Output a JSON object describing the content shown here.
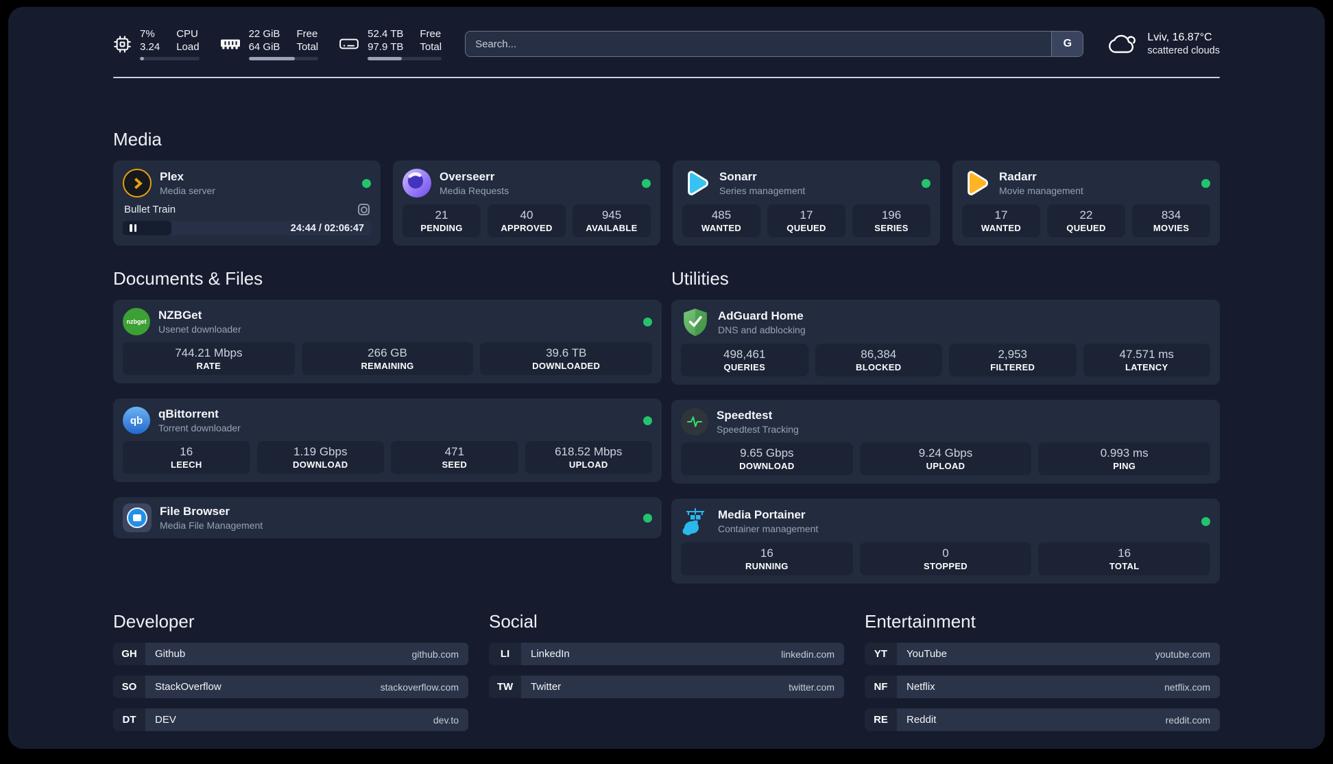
{
  "colors": {
    "status_online": "#24c36d",
    "plex": "#e5a00d",
    "sonarr": "#36c3f1",
    "radarr": "#ffb423",
    "nzbget": "#3da035",
    "qbittorrent": "#468fdd",
    "adguard": "#54ac56",
    "speedtest_pulse": "#2ee56e",
    "portainer": "#29b9ec"
  },
  "header": {
    "stats": [
      {
        "icon": "cpu-icon",
        "values": [
          "7%",
          "3.24"
        ],
        "labels": [
          "CPU",
          "Load"
        ],
        "bar_style": "width:7%"
      },
      {
        "icon": "ram-icon",
        "values": [
          "22 GiB",
          "64 GiB"
        ],
        "labels": [
          "Free",
          "Total"
        ],
        "bar_style": "width:66%"
      },
      {
        "icon": "disk-icon",
        "values": [
          "52.4 TB",
          "97.9 TB"
        ],
        "labels": [
          "Free",
          "Total"
        ],
        "bar_style": "width:46%"
      }
    ],
    "search": {
      "placeholder": "Search...",
      "button": "G"
    },
    "weather": {
      "icon": "cloud-icon",
      "title": "Lviv, 16.87°C",
      "subtitle": "scattered clouds"
    }
  },
  "media": {
    "title": "Media",
    "cards": [
      {
        "name": "Plex",
        "desc": "Media server",
        "icon": "plex-icon",
        "online": true,
        "now_playing": {
          "title": "Bullet Train",
          "time": "24:44 / 02:06:47",
          "bar_style": "width:19.5%"
        }
      },
      {
        "name": "Overseerr",
        "desc": "Media Requests",
        "icon": "overseerr-icon",
        "online": true,
        "stats": [
          {
            "value": "21",
            "label": "PENDING"
          },
          {
            "value": "40",
            "label": "APPROVED"
          },
          {
            "value": "945",
            "label": "AVAILABLE"
          }
        ]
      },
      {
        "name": "Sonarr",
        "desc": "Series management",
        "icon": "sonarr-icon",
        "online": true,
        "stats": [
          {
            "value": "485",
            "label": "WANTED"
          },
          {
            "value": "17",
            "label": "QUEUED"
          },
          {
            "value": "196",
            "label": "SERIES"
          }
        ]
      },
      {
        "name": "Radarr",
        "desc": "Movie management",
        "icon": "radarr-icon",
        "online": true,
        "stats": [
          {
            "value": "17",
            "label": "WANTED"
          },
          {
            "value": "22",
            "label": "QUEUED"
          },
          {
            "value": "834",
            "label": "MOVIES"
          }
        ]
      }
    ]
  },
  "documents": {
    "title": "Documents & Files",
    "cards": [
      {
        "name": "NZBGet",
        "desc": "Usenet downloader",
        "icon": "nzbget-icon",
        "icon_text": "nzbget",
        "online": true,
        "stats": [
          {
            "value": "744.21 Mbps",
            "label": "RATE"
          },
          {
            "value": "266 GB",
            "label": "REMAINING"
          },
          {
            "value": "39.6 TB",
            "label": "DOWNLOADED"
          }
        ]
      },
      {
        "name": "qBittorrent",
        "desc": "Torrent downloader",
        "icon": "qbittorrent-icon",
        "icon_text": "qb",
        "online": true,
        "stats": [
          {
            "value": "16",
            "label": "LEECH"
          },
          {
            "value": "1.19 Gbps",
            "label": "DOWNLOAD"
          },
          {
            "value": "471",
            "label": "SEED"
          },
          {
            "value": "618.52 Mbps",
            "label": "UPLOAD"
          }
        ]
      },
      {
        "name": "File Browser",
        "desc": "Media File Management",
        "icon": "filebrowser-icon",
        "online": true
      }
    ]
  },
  "utilities": {
    "title": "Utilities",
    "cards": [
      {
        "name": "AdGuard Home",
        "desc": "DNS and adblocking",
        "icon": "adguard-icon",
        "stats": [
          {
            "value": "498,461",
            "label": "QUERIES"
          },
          {
            "value": "86,384",
            "label": "BLOCKED"
          },
          {
            "value": "2,953",
            "label": "FILTERED"
          },
          {
            "value": "47.571 ms",
            "label": "LATENCY"
          }
        ]
      },
      {
        "name": "Speedtest",
        "desc": "Speedtest Tracking",
        "icon": "speedtest-icon",
        "stats": [
          {
            "value": "9.65 Gbps",
            "label": "DOWNLOAD"
          },
          {
            "value": "9.24 Gbps",
            "label": "UPLOAD"
          },
          {
            "value": "0.993 ms",
            "label": "PING"
          }
        ]
      },
      {
        "name": "Media Portainer",
        "desc": "Container management",
        "icon": "portainer-icon",
        "online": true,
        "stats": [
          {
            "value": "16",
            "label": "RUNNING"
          },
          {
            "value": "0",
            "label": "STOPPED"
          },
          {
            "value": "16",
            "label": "TOTAL"
          }
        ]
      }
    ]
  },
  "links": {
    "developer": {
      "title": "Developer",
      "items": [
        {
          "abbr": "GH",
          "name": "Github",
          "url": "github.com"
        },
        {
          "abbr": "SO",
          "name": "StackOverflow",
          "url": "stackoverflow.com"
        },
        {
          "abbr": "DT",
          "name": "DEV",
          "url": "dev.to"
        }
      ]
    },
    "social": {
      "title": "Social",
      "items": [
        {
          "abbr": "LI",
          "name": "LinkedIn",
          "url": "linkedin.com"
        },
        {
          "abbr": "TW",
          "name": "Twitter",
          "url": "twitter.com"
        }
      ]
    },
    "entertainment": {
      "title": "Entertainment",
      "items": [
        {
          "abbr": "YT",
          "name": "YouTube",
          "url": "youtube.com"
        },
        {
          "abbr": "NF",
          "name": "Netflix",
          "url": "netflix.com"
        },
        {
          "abbr": "RE",
          "name": "Reddit",
          "url": "reddit.com"
        }
      ]
    }
  }
}
